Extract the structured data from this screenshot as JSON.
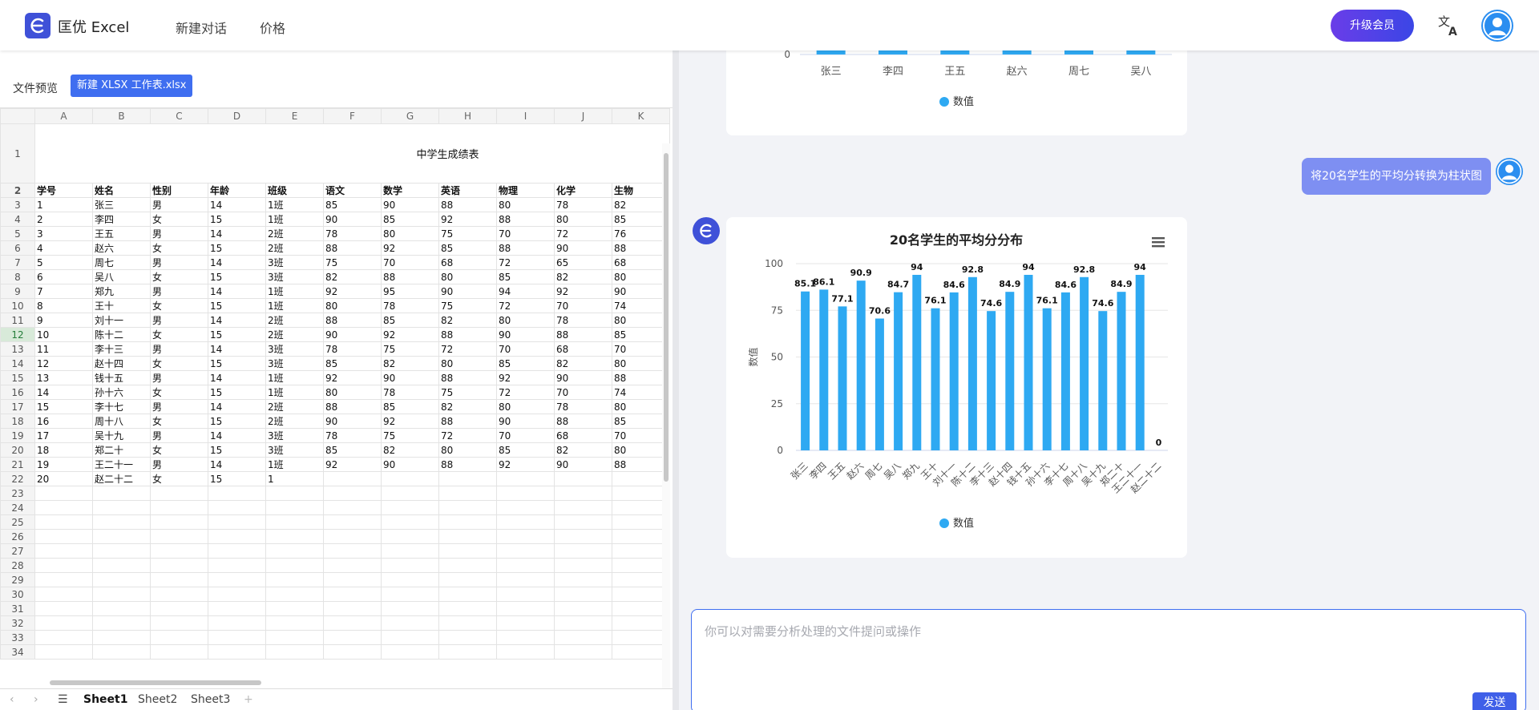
{
  "header": {
    "app_name": "匡优 Excel",
    "nav": [
      "新建对话",
      "价格"
    ],
    "upgrade": "升级会员"
  },
  "preview": {
    "label": "文件预览",
    "file_name": "新建 XLSX 工作表.xlsx",
    "sheet_tabs": [
      "Sheet1",
      "Sheet2",
      "Sheet3"
    ],
    "active_sheet": "Sheet1",
    "columns": [
      "A",
      "B",
      "C",
      "D",
      "E",
      "F",
      "G",
      "H",
      "I",
      "J",
      "K"
    ],
    "title": "中学生成绩表",
    "header_row": [
      "学号",
      "姓名",
      "性别",
      "年龄",
      "班级",
      "语文",
      "数学",
      "英语",
      "物理",
      "化学",
      "生物"
    ],
    "rows": [
      [
        "1",
        "张三",
        "男",
        "14",
        "1班",
        "85",
        "90",
        "88",
        "80",
        "78",
        "82"
      ],
      [
        "2",
        "李四",
        "女",
        "15",
        "1班",
        "90",
        "85",
        "92",
        "88",
        "80",
        "85"
      ],
      [
        "3",
        "王五",
        "男",
        "14",
        "2班",
        "78",
        "80",
        "75",
        "70",
        "72",
        "76"
      ],
      [
        "4",
        "赵六",
        "女",
        "15",
        "2班",
        "88",
        "92",
        "85",
        "88",
        "90",
        "88"
      ],
      [
        "5",
        "周七",
        "男",
        "14",
        "3班",
        "75",
        "70",
        "68",
        "72",
        "65",
        "68"
      ],
      [
        "6",
        "吴八",
        "女",
        "15",
        "3班",
        "82",
        "88",
        "80",
        "85",
        "82",
        "80"
      ],
      [
        "7",
        "郑九",
        "男",
        "14",
        "1班",
        "92",
        "95",
        "90",
        "94",
        "92",
        "90"
      ],
      [
        "8",
        "王十",
        "女",
        "15",
        "1班",
        "80",
        "78",
        "75",
        "72",
        "70",
        "74"
      ],
      [
        "9",
        "刘十一",
        "男",
        "14",
        "2班",
        "88",
        "85",
        "82",
        "80",
        "78",
        "80"
      ],
      [
        "10",
        "陈十二",
        "女",
        "15",
        "2班",
        "90",
        "92",
        "88",
        "90",
        "88",
        "85"
      ],
      [
        "11",
        "李十三",
        "男",
        "14",
        "3班",
        "78",
        "75",
        "72",
        "70",
        "68",
        "70"
      ],
      [
        "12",
        "赵十四",
        "女",
        "15",
        "3班",
        "85",
        "82",
        "80",
        "85",
        "82",
        "80"
      ],
      [
        "13",
        "钱十五",
        "男",
        "14",
        "1班",
        "92",
        "90",
        "88",
        "92",
        "90",
        "88"
      ],
      [
        "14",
        "孙十六",
        "女",
        "15",
        "1班",
        "80",
        "78",
        "75",
        "72",
        "70",
        "74"
      ],
      [
        "15",
        "李十七",
        "男",
        "14",
        "2班",
        "88",
        "85",
        "82",
        "80",
        "78",
        "80"
      ],
      [
        "16",
        "周十八",
        "女",
        "15",
        "2班",
        "90",
        "92",
        "88",
        "90",
        "88",
        "85"
      ],
      [
        "17",
        "吴十九",
        "男",
        "14",
        "3班",
        "78",
        "75",
        "72",
        "70",
        "68",
        "70"
      ],
      [
        "18",
        "郑二十",
        "女",
        "15",
        "3班",
        "85",
        "82",
        "80",
        "85",
        "82",
        "80"
      ],
      [
        "19",
        "王二十一",
        "男",
        "14",
        "1班",
        "92",
        "90",
        "88",
        "92",
        "90",
        "88"
      ],
      [
        "20",
        "赵二十二",
        "女",
        "15",
        "1",
        "",
        "",
        "",
        "",
        "",
        ""
      ]
    ],
    "row_numbers": [
      "1",
      "2",
      "3",
      "4",
      "5",
      "6",
      "7",
      "8",
      "9",
      "10",
      "11",
      "12",
      "13",
      "14",
      "15",
      "16",
      "17",
      "18",
      "19",
      "20",
      "21",
      "22",
      "23",
      "24",
      "25",
      "26",
      "27",
      "28",
      "29",
      "30",
      "31",
      "32",
      "33",
      "34"
    ],
    "active_row": "12"
  },
  "chat": {
    "user_message": "将20名学生的平均分转换为柱状图",
    "input_placeholder": "你可以对需要分析处理的文件提问或操作",
    "send": "发送"
  },
  "colors": {
    "bar": "#2ea9f2",
    "accent": "#3f51d8",
    "upgrade_gradient": [
      "#6a3de8",
      "#3b46e6"
    ]
  },
  "chart_data": [
    {
      "type": "bar",
      "title": "",
      "categories": [
        "张三",
        "李四",
        "王五",
        "赵六",
        "周七",
        "吴八"
      ],
      "series": [
        {
          "name": "数值",
          "values": [
            null,
            null,
            null,
            null,
            null,
            null
          ]
        }
      ],
      "ytick_visible": [
        "0"
      ],
      "legend": "bottom-center"
    },
    {
      "type": "bar",
      "title": "20名学生的平均分分布",
      "ylabel": "数值",
      "ylim": [
        0,
        100
      ],
      "yticks": [
        0,
        25,
        50,
        75,
        100
      ],
      "grid": true,
      "legend": "bottom-center",
      "categories": [
        "张三",
        "李四",
        "王五",
        "赵六",
        "周七",
        "吴八",
        "郑九",
        "王十",
        "刘十一",
        "陈十二",
        "李十三",
        "赵十四",
        "钱十五",
        "孙十六",
        "李十七",
        "周十八",
        "吴十九",
        "郑二十",
        "王二十一",
        "赵二十二"
      ],
      "series": [
        {
          "name": "数值",
          "values": [
            85.1,
            86.1,
            77.1,
            90.9,
            70.6,
            84.7,
            94,
            76.1,
            84.6,
            92.8,
            74.6,
            84.9,
            94,
            76.1,
            84.6,
            92.8,
            74.6,
            84.9,
            94,
            0
          ]
        }
      ],
      "data_labels": [
        "85.1",
        "86.1",
        "77.1",
        "90.9",
        "70.6",
        "84.7",
        "94",
        "76.1",
        "84.6",
        "92.8",
        "74.6",
        "84.9",
        "94",
        "76.1",
        "84.6",
        "92.8",
        "74.6",
        "84.9",
        "94",
        "0"
      ]
    }
  ]
}
